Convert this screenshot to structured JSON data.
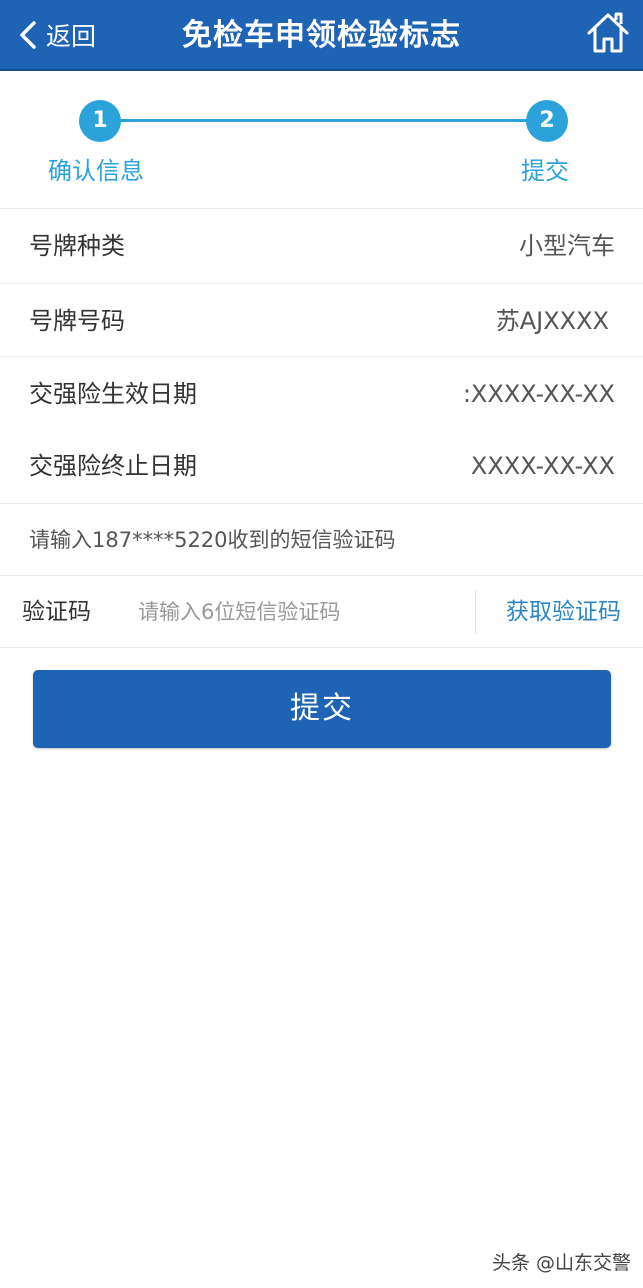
{
  "header": {
    "back_label": "返回",
    "title": "免检车申领检验标志",
    "background_color": "#1f63b5",
    "back_icon": "chevron-left-icon",
    "home_icon": "home-icon"
  },
  "stepper": {
    "accent_color": "#2ba2d9",
    "steps": [
      {
        "number": "1",
        "label": "确认信息"
      },
      {
        "number": "2",
        "label": "提交"
      }
    ]
  },
  "vehicle_info": [
    {
      "label": "号牌种类",
      "value": "小型汽车"
    },
    {
      "label": "号牌号码",
      "value": "苏AJXXXX"
    },
    {
      "label": "交强险生效日期",
      "value": ":XXXX-XX-XX"
    },
    {
      "label": "交强险终止日期",
      "value": "XXXX-XX-XX"
    }
  ],
  "sms": {
    "hint": "请输入187****5220收到的短信验证码",
    "code_label": "验证码",
    "code_placeholder": "请输入6位短信验证码",
    "code_value": "",
    "get_code_label": "获取验证码"
  },
  "submit": {
    "label": "提交"
  },
  "watermark": "头条 @山东交警"
}
